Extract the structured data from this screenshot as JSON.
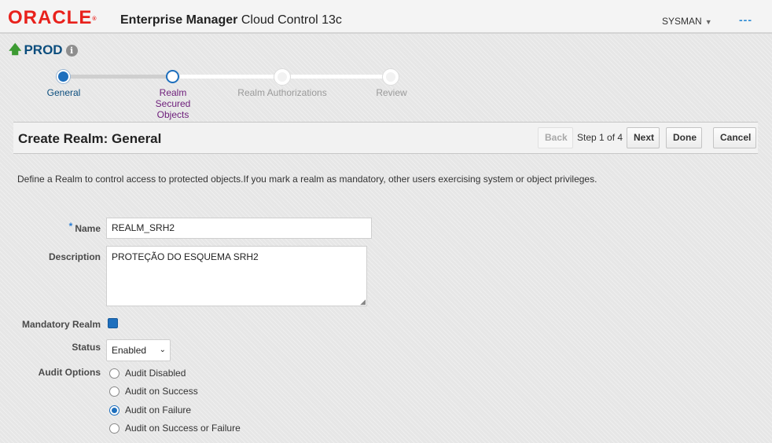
{
  "header": {
    "logo": "ORACLE",
    "logo_reg": "®",
    "app_title_bold": "Enterprise Manager",
    "app_title_rest": "Cloud Control 13c",
    "user": "SYSMAN",
    "more_glyph": "---"
  },
  "target": {
    "name": "PROD",
    "status_icon": "up-arrow-icon",
    "info_glyph": "i"
  },
  "train": {
    "steps": [
      {
        "label": "General",
        "state": "current"
      },
      {
        "label": "Realm Secured Objects",
        "state": "visited"
      },
      {
        "label": "Realm Authorizations",
        "state": "disabled"
      },
      {
        "label": "Review",
        "state": "disabled"
      }
    ]
  },
  "section": {
    "title": "Create Realm: General",
    "back_label": "Back",
    "step_text": "Step 1 of 4",
    "next_label": "Next",
    "done_label": "Done",
    "cancel_label": "Cancel"
  },
  "description": "Define a Realm to control access to protected objects.If you mark a realm as mandatory,  other users exercising system or object privileges.",
  "form": {
    "required_marker": "*",
    "name_label": "Name",
    "name_value": "REALM_SRH2",
    "description_label": "Description",
    "description_value": "PROTEÇÃO DO ESQUEMA SRH2",
    "mandatory_label": "Mandatory Realm",
    "mandatory_checked": true,
    "status_label": "Status",
    "status_value": "Enabled",
    "audit_label": "Audit Options",
    "audit_options": [
      {
        "label": "Audit Disabled",
        "checked": false
      },
      {
        "label": "Audit on Success",
        "checked": false
      },
      {
        "label": "Audit on Failure",
        "checked": true
      },
      {
        "label": "Audit on Success or Failure",
        "checked": false
      }
    ]
  },
  "colors": {
    "brand_red": "#e8211c",
    "accent_blue": "#1e6fbd",
    "target_blue": "#0b4d7d",
    "visited_purple": "#6d1d7a"
  }
}
